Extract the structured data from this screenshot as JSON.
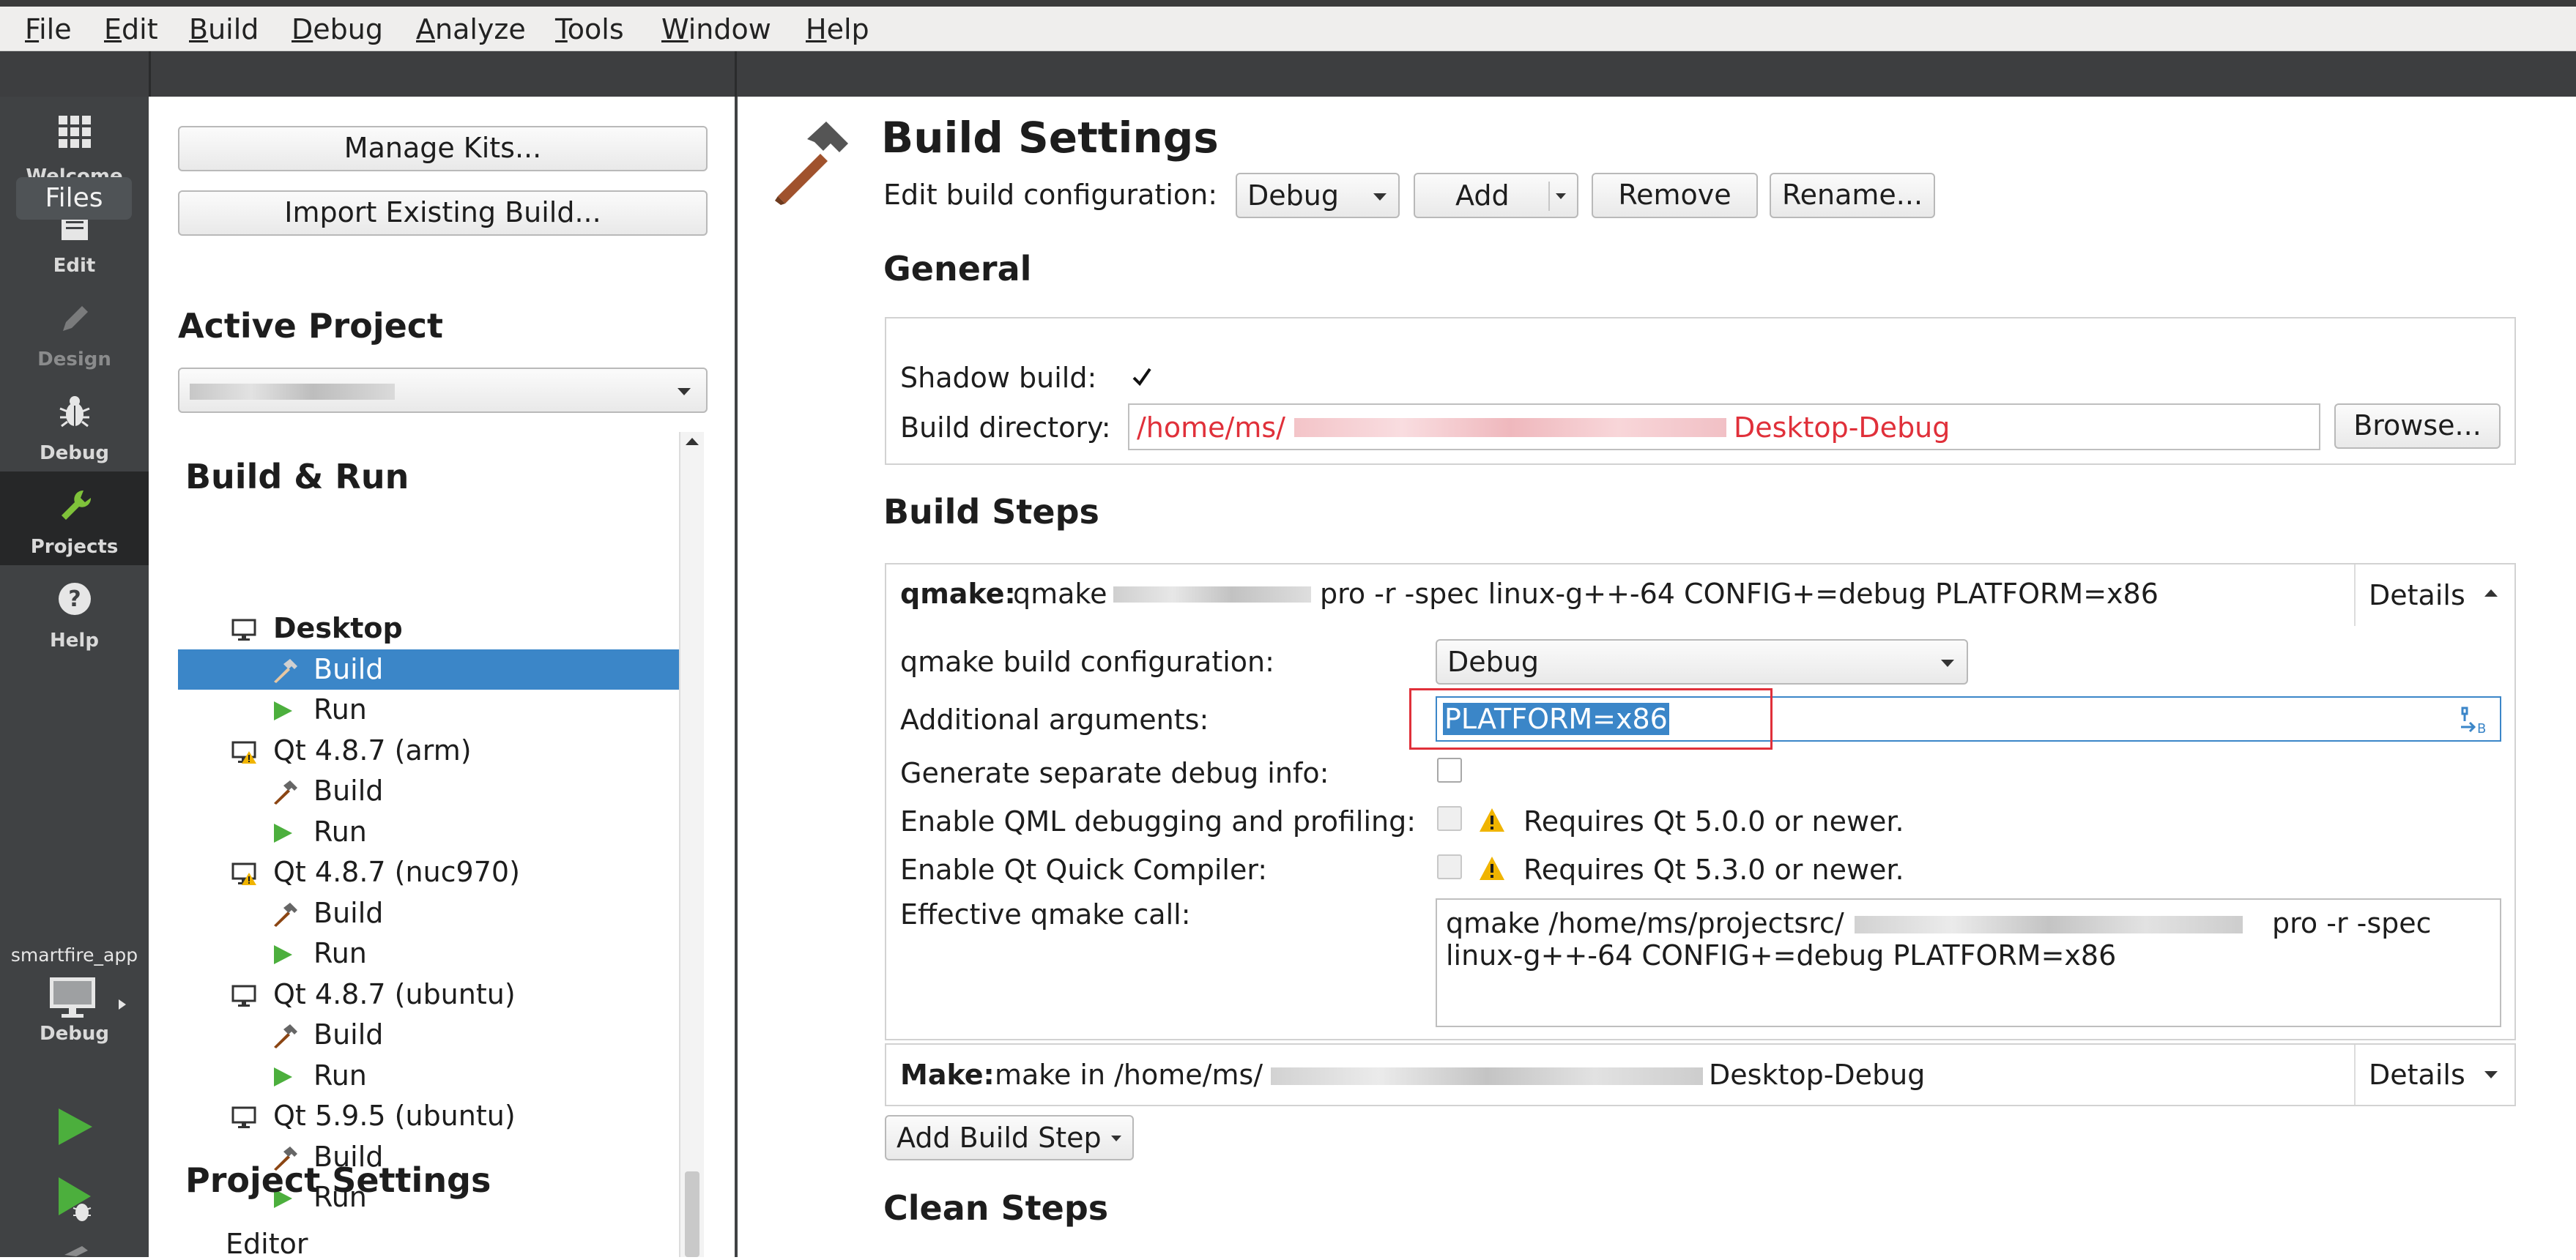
{
  "menu": [
    "File",
    "Edit",
    "Build",
    "Debug",
    "Analyze",
    "Tools",
    "Window",
    "Help"
  ],
  "modes": {
    "welcome": "Welcome",
    "files_overlay": "Files",
    "edit": "Edit",
    "design": "Design",
    "debug": "Debug",
    "projects": "Projects",
    "help": "Help",
    "project_name": "smartfire_app",
    "target_mode": "Debug"
  },
  "left": {
    "manage_kits": "Manage Kits...",
    "import_build": "Import Existing Build...",
    "active_project": "Active Project",
    "build_run": "Build & Run",
    "project_settings": "Project Settings",
    "editor": "Editor",
    "tree": [
      {
        "kind": "kit",
        "label": "Desktop",
        "icon": "monitor-icon",
        "bold": true
      },
      {
        "kind": "build",
        "label": "Build",
        "icon": "hammer-icon",
        "selected": true
      },
      {
        "kind": "run",
        "label": "Run",
        "icon": "run-icon"
      },
      {
        "kind": "kit",
        "label": "Qt 4.8.7 (arm)",
        "icon": "monitor-warning-icon"
      },
      {
        "kind": "build",
        "label": "Build",
        "icon": "hammer-icon"
      },
      {
        "kind": "run",
        "label": "Run",
        "icon": "run-icon"
      },
      {
        "kind": "kit",
        "label": "Qt 4.8.7 (nuc970)",
        "icon": "monitor-warning-icon"
      },
      {
        "kind": "build",
        "label": "Build",
        "icon": "hammer-icon"
      },
      {
        "kind": "run",
        "label": "Run",
        "icon": "run-icon"
      },
      {
        "kind": "kit",
        "label": "Qt 4.8.7 (ubuntu)",
        "icon": "monitor-icon"
      },
      {
        "kind": "build",
        "label": "Build",
        "icon": "hammer-icon"
      },
      {
        "kind": "run",
        "label": "Run",
        "icon": "run-icon"
      },
      {
        "kind": "kit",
        "label": "Qt 5.9.5 (ubuntu)",
        "icon": "monitor-icon"
      },
      {
        "kind": "build",
        "label": "Build",
        "icon": "hammer-icon"
      },
      {
        "kind": "run",
        "label": "Run",
        "icon": "run-icon"
      }
    ]
  },
  "main": {
    "title": "Build Settings",
    "edit_config_label": "Edit build configuration:",
    "config_value": "Debug",
    "add_label": "Add",
    "remove_label": "Remove",
    "rename_label": "Rename...",
    "general": "General",
    "shadow_build_label": "Shadow build:",
    "shadow_build_checked": true,
    "build_dir_label": "Build directory:",
    "build_dir_prefix": "/home/ms/",
    "build_dir_suffix": "Desktop-Debug",
    "browse_label": "Browse...",
    "build_steps": "Build Steps",
    "qmake_step": {
      "prefix": "qmake:",
      "cmd_start": "qmake",
      "cmd_rest": "pro -r -spec linux-g++-64 CONFIG+=debug PLATFORM=x86",
      "details": "Details",
      "qmake_config_label": "qmake build configuration:",
      "qmake_config_value": "Debug",
      "additional_args_label": "Additional arguments:",
      "additional_args_value": "PLATFORM=x86",
      "separate_debug_label": "Generate separate debug info:",
      "qml_debug_label": "Enable QML debugging and profiling:",
      "qml_debug_note": "Requires Qt 5.0.0 or newer.",
      "quick_compiler_label": "Enable Qt Quick Compiler:",
      "quick_compiler_note": "Requires Qt 5.3.0 or newer.",
      "effective_label": "Effective qmake call:",
      "effective_line1_start": "qmake /home/ms/projectsrc/",
      "effective_line1_end": "pro -r -spec",
      "effective_line2": "linux-g++-64 CONFIG+=debug PLATFORM=x86"
    },
    "make_step": {
      "prefix": "Make:",
      "cmd_start": "make in /home/ms/",
      "cmd_end": "Desktop-Debug",
      "details": "Details"
    },
    "add_build_step": "Add Build Step",
    "clean_steps": "Clean Steps"
  },
  "colors": {
    "accent": "#3b86c8",
    "path_red": "#e0303a",
    "highlight_border": "#e0303a",
    "modebar": "#404244",
    "run_green": "#4caf3d"
  }
}
